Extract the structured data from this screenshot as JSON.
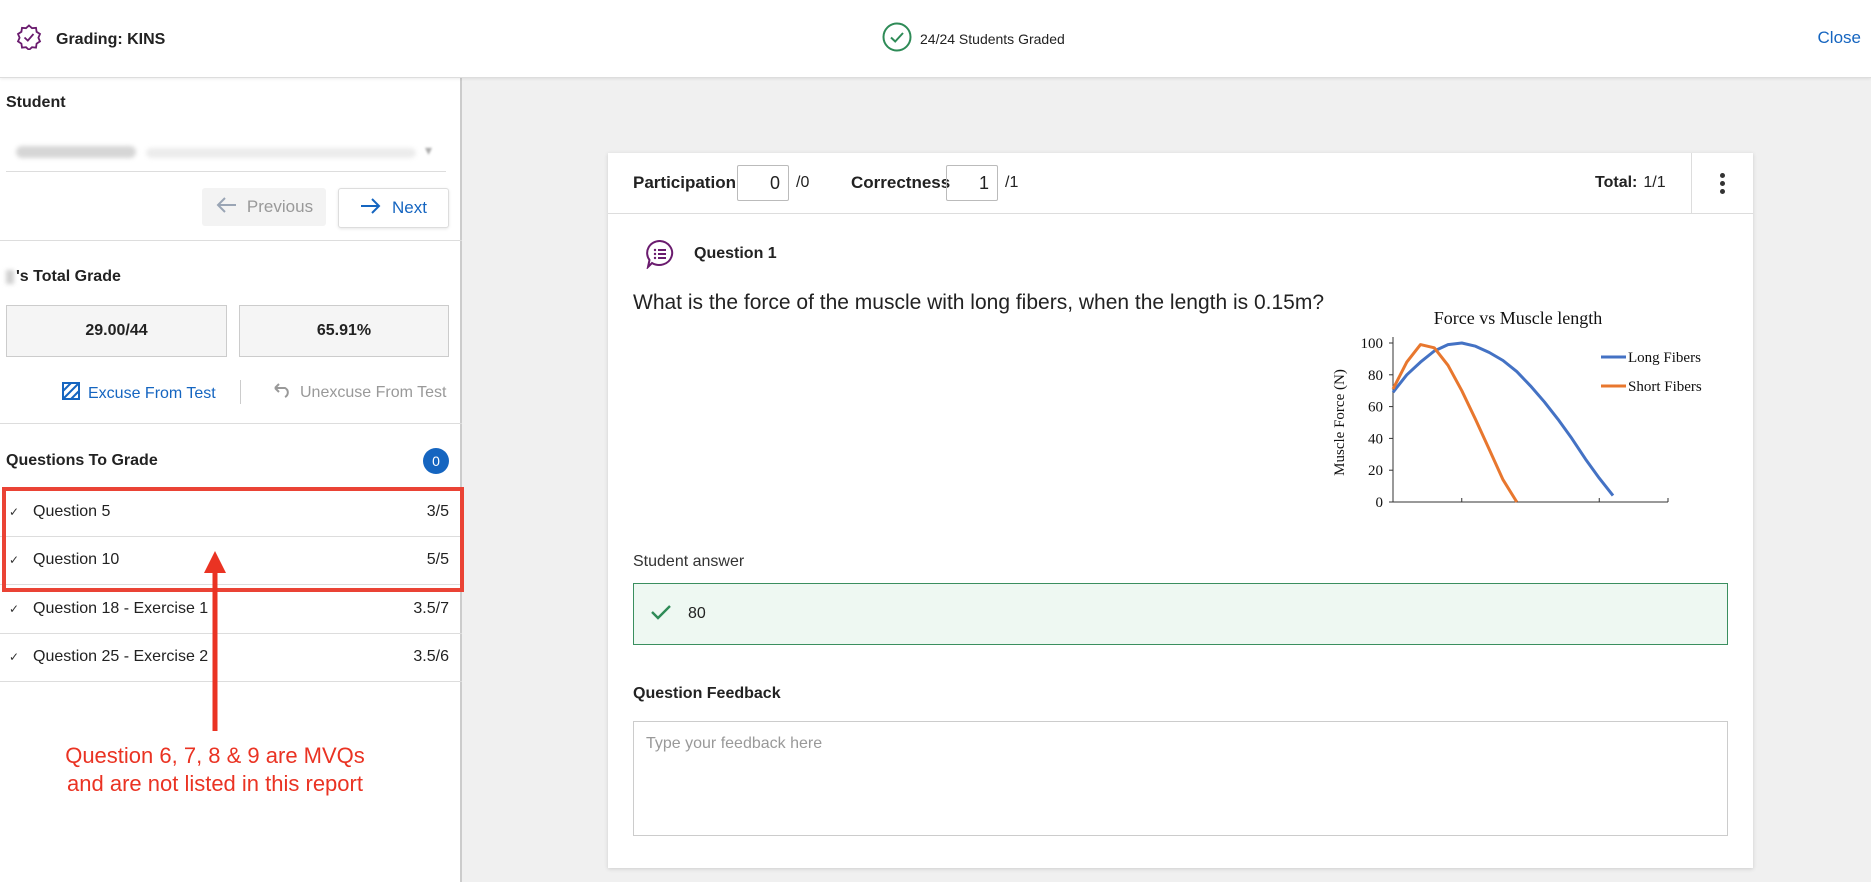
{
  "header": {
    "title": "Grading: KINS",
    "status": "24/24 Students Graded",
    "close_label": "Close"
  },
  "sidebar": {
    "student_label": "Student",
    "prev_label": "Previous",
    "next_label": "Next",
    "total_grade_label": "'s Total Grade",
    "grade_points": "29.00/44",
    "grade_percent": "65.91%",
    "excuse_label": "Excuse From Test",
    "unexcuse_label": "Unexcuse From Test",
    "questions_label": "Questions To Grade",
    "questions_count": "0",
    "questions": [
      {
        "name": "Question 5",
        "score": "3/5"
      },
      {
        "name": "Question 10",
        "score": "5/5"
      },
      {
        "name": "Question 18 - Exercise 1",
        "score": "3.5/7"
      },
      {
        "name": "Question 25 - Exercise 2",
        "score": "3.5/6"
      }
    ],
    "annotation_line1": "Question 6, 7, 8 & 9 are MVQs",
    "annotation_line2": "and are not listed in this report"
  },
  "grading": {
    "participation_label": "Participation",
    "participation_value": "0",
    "participation_max": "/0",
    "correctness_label": "Correctness",
    "correctness_value": "1",
    "correctness_max": "/1",
    "total_label": "Total:",
    "total_value": "1/1"
  },
  "question": {
    "title": "Question 1",
    "text": "What is the force of the muscle with long fibers, when the length is 0.15m?",
    "answer_label": "Student answer",
    "answer_value": "80",
    "feedback_label": "Question Feedback",
    "feedback_placeholder": "Type your feedback here"
  },
  "colors": {
    "accent": "#1565c0",
    "annotation": "#ea4335",
    "correct": "#3a8f5f",
    "long_fibers": "#4472c4",
    "short_fibers": "#e8772e"
  },
  "chart_data": {
    "type": "line",
    "title": "Force vs Muscle length",
    "xlabel": "",
    "ylabel": "Muscle Force (N)",
    "yticks": [
      0,
      20,
      40,
      60,
      80,
      100
    ],
    "ylim": [
      0,
      100
    ],
    "xlim": [
      0,
      1
    ],
    "legend_position": "top-right",
    "series": [
      {
        "name": "Long Fibers",
        "color": "#4472c4",
        "x": [
          0,
          0.05,
          0.1,
          0.15,
          0.2,
          0.25,
          0.3,
          0.35,
          0.4,
          0.45,
          0.5,
          0.55,
          0.6,
          0.65,
          0.7,
          0.75,
          0.8,
          0.85,
          0.9,
          0.95,
          1.0
        ],
        "y": [
          69,
          80,
          88,
          95,
          99,
          100,
          98,
          94,
          89,
          82,
          73,
          63,
          52,
          40,
          27,
          15,
          4,
          null,
          null,
          null,
          null
        ]
      },
      {
        "name": "Short Fibers",
        "color": "#e8772e",
        "x": [
          0,
          0.05,
          0.1,
          0.15,
          0.2,
          0.25,
          0.3,
          0.35,
          0.4,
          0.45,
          0.5,
          0.55,
          0.6
        ],
        "y": [
          71,
          88,
          99,
          97,
          86,
          70,
          52,
          33,
          14,
          0,
          null,
          null,
          null
        ]
      }
    ]
  }
}
